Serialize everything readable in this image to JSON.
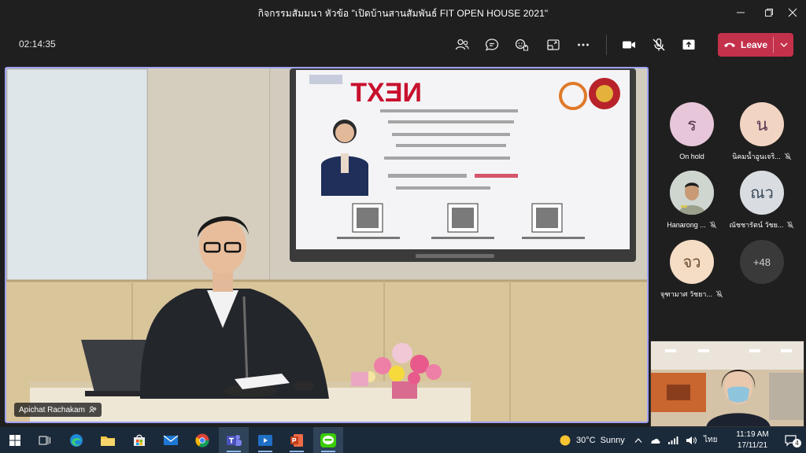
{
  "window": {
    "title": "กิจกรรมสัมมนา หัวข้อ \"เปิดบ้านสานสัมพันธ์ FIT OPEN HOUSE 2021\""
  },
  "toolbar": {
    "timer": "02:14:35",
    "leave_label": "Leave"
  },
  "main_video": {
    "speaker_name": "Apichat Rachakam",
    "slide_heading": "NEXT"
  },
  "participants": [
    {
      "initials": "ร",
      "name": "On hold",
      "bg": "#e7c6da",
      "muted": false
    },
    {
      "initials": "น",
      "name": "นิคมน้ำอูนเจริ...",
      "bg": "#f2d4c2",
      "muted": true
    },
    {
      "initials": "",
      "name": "Hanarong ...",
      "bg": "#d9d9d9",
      "muted": true,
      "photo": true
    },
    {
      "initials": "ณว",
      "name": "ณัชชารัตน์ วัชย...",
      "bg": "#d9dde2",
      "muted": true
    },
    {
      "initials": "จว",
      "name": "จุฑามาศ วัชยา...",
      "bg": "#f5dcc5",
      "muted": true
    }
  ],
  "overflow_count": "+48",
  "taskbar": {
    "weather_temp": "30°C",
    "weather_desc": "Sunny",
    "language": "ไทย",
    "time": "11:19 AM",
    "date": "17/11/21",
    "notification_count": "4"
  },
  "colors": {
    "leave": "#c4314b",
    "active_border": "#9ea2ff",
    "taskbar": "#1b2a3a"
  }
}
